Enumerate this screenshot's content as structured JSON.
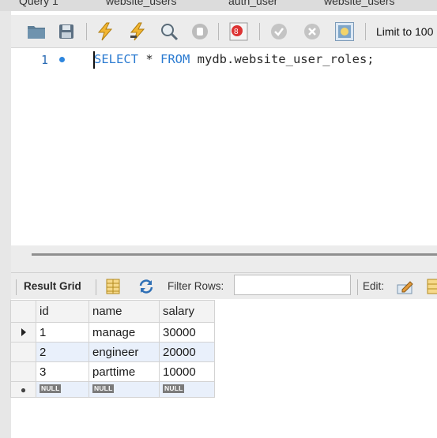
{
  "tabs": [
    {
      "label": "Query 1"
    },
    {
      "label": "website_users"
    },
    {
      "label": "auth_user"
    },
    {
      "label": "website_users"
    }
  ],
  "toolbar": {
    "icons": [
      "folder-open-icon",
      "save-icon",
      "execute-lightning-icon",
      "execute-cursor-lightning-icon",
      "explain-magnifier-icon",
      "stop-icon",
      "toggle-stop-on-error-icon",
      "commit-icon",
      "rollback-icon",
      "autocommit-toggle-icon"
    ],
    "limit_label": "Limit to 100"
  },
  "editor": {
    "line_number": "1",
    "sql_keyword_1": "SELECT",
    "sql_star": " * ",
    "sql_keyword_2": "FROM",
    "sql_rest": " mydb.website_user_roles;"
  },
  "result_toolbar": {
    "result_grid_label": "Result Grid",
    "filter_label": "Filter Rows:",
    "filter_value": "",
    "edit_label": "Edit:"
  },
  "grid": {
    "columns": [
      "id",
      "name",
      "salary"
    ],
    "rows": [
      {
        "id": "1",
        "name": "manage",
        "salary": "30000"
      },
      {
        "id": "2",
        "name": "engineer",
        "salary": "20000"
      },
      {
        "id": "3",
        "name": "parttime",
        "salary": "10000"
      }
    ],
    "null_label": "NULL"
  },
  "colors": {
    "keyword": "#2b7bd1",
    "line_number": "#2d6db5",
    "alt_row": "#e9f0fb",
    "toolbar_bg": "#ececec"
  }
}
